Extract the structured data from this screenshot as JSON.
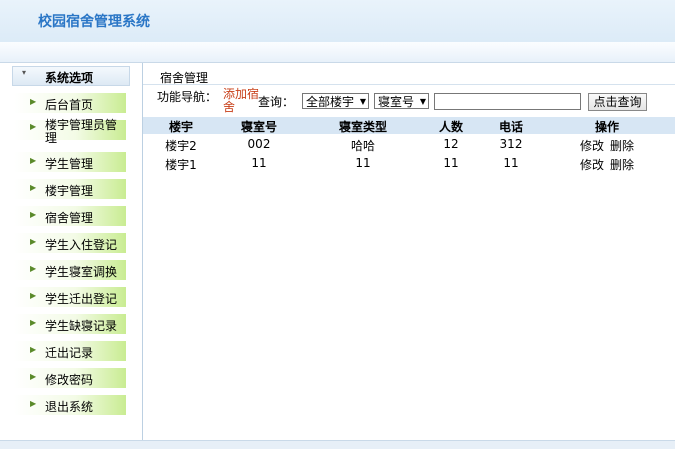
{
  "app": {
    "title": "校园宿舍管理系统"
  },
  "sidebar": {
    "header": "系统选项",
    "items": [
      {
        "label": "后台首页"
      },
      {
        "label": "楼宇管理员管理"
      },
      {
        "label": "学生管理"
      },
      {
        "label": "楼宇管理"
      },
      {
        "label": "宿舍管理"
      },
      {
        "label": "学生入住登记"
      },
      {
        "label": "学生寝室调换"
      },
      {
        "label": "学生迁出登记"
      },
      {
        "label": "学生缺寝记录"
      },
      {
        "label": "迁出记录"
      },
      {
        "label": "修改密码"
      },
      {
        "label": "退出系统"
      }
    ]
  },
  "main": {
    "title": "宿舍管理",
    "nav_label": "功能导航：",
    "nav_link": "添加宿舍",
    "query_label": "查询：",
    "select_building": "全部楼宇",
    "select_field": "寝室号",
    "search_value": "",
    "search_button": "点击查询",
    "columns": [
      "楼宇",
      "寝室号",
      "寝室类型",
      "人数",
      "电话",
      "操作"
    ],
    "rows": [
      {
        "building": "楼宇2",
        "room": "002",
        "type": "哈哈",
        "count": "12",
        "phone": "312",
        "edit": "修改",
        "delete": "删除"
      },
      {
        "building": "楼宇1",
        "room": "11",
        "type": "11",
        "count": "11",
        "phone": "11",
        "edit": "修改",
        "delete": "删除"
      }
    ]
  }
}
